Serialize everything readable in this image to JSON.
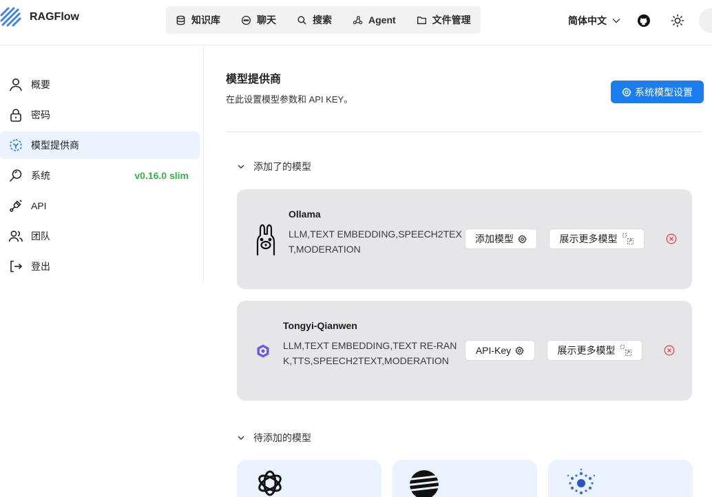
{
  "app": {
    "name": "RAGFlow"
  },
  "nav": {
    "items": [
      {
        "label": "知识库",
        "icon": "database-icon"
      },
      {
        "label": "聊天",
        "icon": "chat-bubble-icon"
      },
      {
        "label": "搜索",
        "icon": "search-icon"
      },
      {
        "label": "Agent",
        "icon": "agent-graph-icon"
      },
      {
        "label": "文件管理",
        "icon": "folder-icon"
      }
    ]
  },
  "header": {
    "language": "简体中文"
  },
  "sidebar": {
    "items": [
      {
        "label": "概要",
        "icon": "user-icon"
      },
      {
        "label": "密码",
        "icon": "lock-icon"
      },
      {
        "label": "模型提供商",
        "icon": "model-provider-icon",
        "active": true
      },
      {
        "label": "系统",
        "icon": "system-search-icon",
        "version": "v0.16.0 slim"
      },
      {
        "label": "API",
        "icon": "plug-icon"
      },
      {
        "label": "团队",
        "icon": "team-icon"
      },
      {
        "label": "登出",
        "icon": "logout-icon"
      }
    ]
  },
  "main": {
    "title": "模型提供商",
    "description": "在此设置模型参数和 API KEY。",
    "system_button": "系统模型设置",
    "added_section": "添加了的模型",
    "pending_section": "待添加的模型",
    "added_models": [
      {
        "name": "Ollama",
        "tags": "LLM,TEXT EMBEDDING,SPEECH2TEXT,MODERATION",
        "primary_button": "添加模型",
        "more_button": "展示更多模型"
      },
      {
        "name": "Tongyi-Qianwen",
        "tags": "LLM,TEXT EMBEDDING,TEXT RE-RANK,TTS,SPEECH2TEXT,MODERATION",
        "primary_button": "API-Key",
        "more_button": "展示更多模型"
      }
    ]
  },
  "colors": {
    "accent": "#1a7ef0",
    "version_green": "#34b544",
    "remove_red": "#e5484d",
    "active_bg": "#eaf3fe",
    "card_bg": "#e6e6e9"
  }
}
